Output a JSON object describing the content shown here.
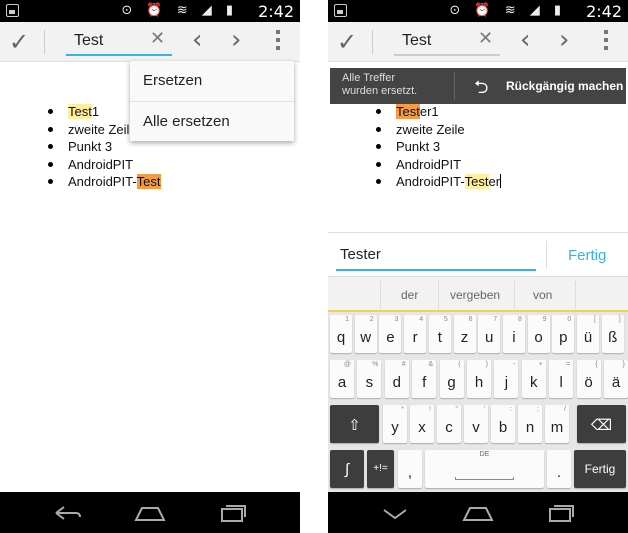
{
  "status_bar": {
    "time": "2:42",
    "icons": "⊙ ⏰ ≋ ◢ ▮"
  },
  "find_bar": {
    "confirm_icon": "✓",
    "clear_icon": "✕",
    "prev_icon": "‹",
    "next_icon": "›",
    "left_search_value": "Test",
    "right_search_value": "Test"
  },
  "left_popup": {
    "items": [
      "Ersetzen",
      "Alle ersetzen"
    ]
  },
  "left_doc": [
    {
      "parts": [
        {
          "text": "Test",
          "hl": "y"
        },
        {
          "text": "1"
        }
      ]
    },
    {
      "parts": [
        {
          "text": "zweite Zeile"
        }
      ]
    },
    {
      "parts": [
        {
          "text": "Punkt 3"
        }
      ]
    },
    {
      "parts": [
        {
          "text": "AndroidPIT"
        }
      ]
    },
    {
      "parts": [
        {
          "text": "AndroidPIT-"
        },
        {
          "text": "Test",
          "hl": "o"
        }
      ]
    }
  ],
  "right_doc": [
    {
      "parts": [
        {
          "text": "Test",
          "hl": "o"
        },
        {
          "text": "er1"
        }
      ]
    },
    {
      "parts": [
        {
          "text": "zweite Zeile"
        }
      ]
    },
    {
      "parts": [
        {
          "text": "Punkt 3"
        }
      ]
    },
    {
      "parts": [
        {
          "text": "AndroidPIT"
        }
      ]
    },
    {
      "parts": [
        {
          "text": "AndroidPIT-"
        },
        {
          "text": "Test",
          "hl": "y"
        },
        {
          "text": "er"
        }
      ],
      "cursor": true
    }
  ],
  "toast": {
    "message_line1": "Alle Treffer",
    "message_line2": "wurden ersetzt.",
    "undo_icon": "⮌",
    "undo_label": "Rückgängig machen"
  },
  "replace_bar": {
    "value": "Tester",
    "done_label": "Fertig"
  },
  "suggestions": [
    "der",
    "vergeben",
    "von"
  ],
  "keyboard": {
    "row1": [
      {
        "k": "q",
        "s": "1"
      },
      {
        "k": "w",
        "s": "2"
      },
      {
        "k": "e",
        "s": "3"
      },
      {
        "k": "r",
        "s": "4"
      },
      {
        "k": "t",
        "s": "5"
      },
      {
        "k": "z",
        "s": "6"
      },
      {
        "k": "u",
        "s": "7"
      },
      {
        "k": "i",
        "s": "8"
      },
      {
        "k": "o",
        "s": "9"
      },
      {
        "k": "p",
        "s": "0"
      },
      {
        "k": "ü",
        "s": "["
      },
      {
        "k": "ß",
        "s": "]"
      }
    ],
    "row2": [
      {
        "k": "a",
        "s": "@"
      },
      {
        "k": "s",
        "s": "%"
      },
      {
        "k": "d",
        "s": "#"
      },
      {
        "k": "f",
        "s": "&"
      },
      {
        "k": "g",
        "s": "("
      },
      {
        "k": "h",
        "s": ")"
      },
      {
        "k": "j",
        "s": "-"
      },
      {
        "k": "k",
        "s": "+"
      },
      {
        "k": "l",
        "s": "="
      },
      {
        "k": "ö",
        "s": "{"
      },
      {
        "k": "ä",
        "s": "}"
      }
    ],
    "row3": [
      {
        "k": "y",
        "s": "*"
      },
      {
        "k": "x",
        "s": "!"
      },
      {
        "k": "c",
        "s": "\""
      },
      {
        "k": "v",
        "s": "'"
      },
      {
        "k": "b",
        "s": ":"
      },
      {
        "k": "n",
        "s": ";"
      },
      {
        "k": "m",
        "s": "/"
      }
    ],
    "shift_icon": "⇧",
    "backspace_icon": "⌫",
    "swype_icon": "∫",
    "symbols_label": "+!=",
    "comma_label": ",",
    "space_label": "DE",
    "period_label": ".",
    "enter_label": "Fertig"
  }
}
